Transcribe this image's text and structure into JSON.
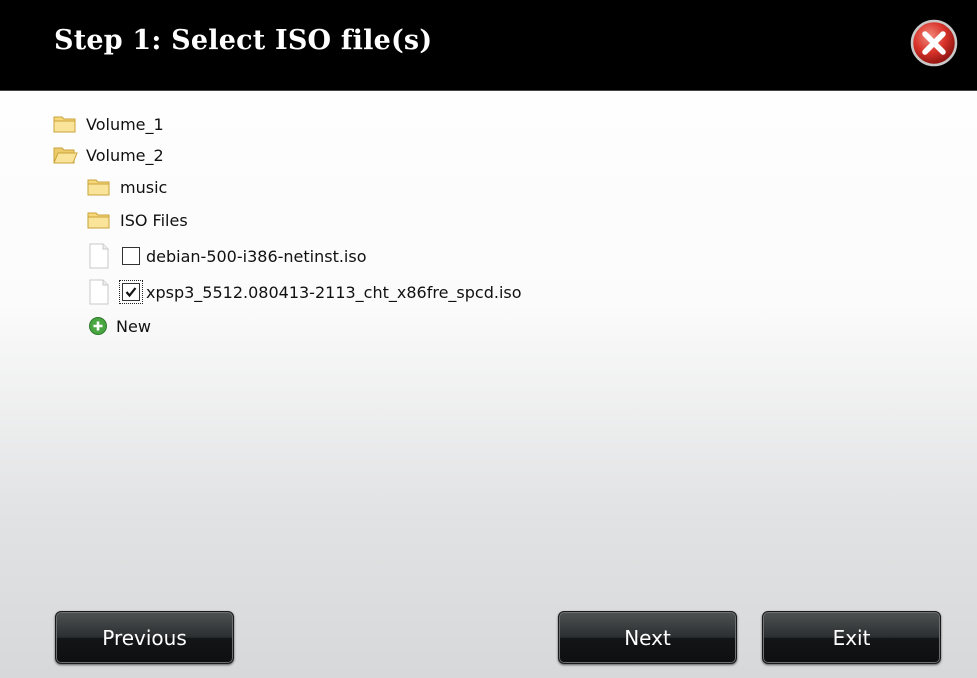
{
  "dialog": {
    "title": "Step 1: Select ISO file(s)"
  },
  "tree": {
    "volume_1": "Volume_1",
    "volume_2": "Volume_2",
    "music": "music",
    "iso_files": "ISO Files",
    "files": [
      {
        "name": "debian-500-i386-netinst.iso",
        "checked": false
      },
      {
        "name": "xpsp3_5512.080413-2113_cht_x86fre_spcd.iso",
        "checked": true
      }
    ],
    "new_label": "New"
  },
  "buttons": {
    "previous": "Previous",
    "next": "Next",
    "exit": "Exit"
  },
  "icons": {
    "close": "close-icon",
    "folder_closed": "folder-icon",
    "folder_open": "folder-open-icon",
    "file": "file-icon",
    "add": "add-icon"
  },
  "colors": {
    "titlebar": "#000000",
    "close_red": "#d9342b",
    "folder_yellow": "#f5d87a",
    "add_green": "#4aa641"
  }
}
